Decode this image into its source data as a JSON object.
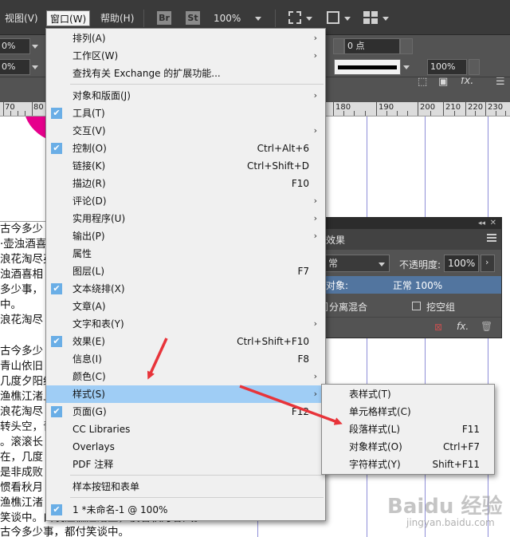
{
  "menubar": {
    "items": [
      {
        "label": "视图(V)"
      },
      {
        "label": "窗口(W)",
        "active": true
      },
      {
        "label": "帮助(H)"
      }
    ],
    "bridge_badge": "Br",
    "stock_badge": "St",
    "zoom": "100%"
  },
  "control": {
    "left_value_1": "0%",
    "left_value_2": "0%",
    "stroke_weight": "0 点",
    "opacity": "100%",
    "fx_label": "fx."
  },
  "ruler": {
    "ticks": [
      "70",
      "80",
      "180",
      "190",
      "200",
      "210",
      "220",
      "230"
    ]
  },
  "document": {
    "lines": [
      "古今多少",
      "·壶浊酒喜",
      "浪花淘尽英",
      "浊酒喜相",
      "多少事，",
      "中。",
      "浪花淘尽",
      "",
      "古今多少",
      "青山依旧",
      "几度夕阳红。",
      "渔樵江渚上，",
      "浪花淘尽",
      "转头空，青",
      "。滚滚长",
      "在，几度",
      "是非成败",
      "惯看秋月",
      "渔樵江渚",
      "笑谈中。白发渔樵江渚上，惯看秋月春风。",
      "古今多少事，都付笑谈中。"
    ]
  },
  "effects_panel": {
    "tab_title": "效果",
    "blend_mode": "常",
    "opacity_label": "不透明度:",
    "opacity_value": "100%",
    "object_label": "对象:",
    "object_value": "正常 100%",
    "isolate_label": "分离混合",
    "knockout_label": "挖空组",
    "fx_label": "fx."
  },
  "window_menu": {
    "items": [
      {
        "label": "排列(A)",
        "submenu": true
      },
      {
        "label": "工作区(W)",
        "submenu": true
      },
      {
        "label": "查找有关 Exchange 的扩展功能..."
      },
      {
        "label": "对象和版面(J)",
        "submenu": true
      },
      {
        "label": "工具(T)",
        "checked": true
      },
      {
        "label": "交互(V)",
        "submenu": true
      },
      {
        "label": "控制(O)",
        "shortcut": "Ctrl+Alt+6",
        "checked": true
      },
      {
        "label": "链接(K)",
        "shortcut": "Ctrl+Shift+D"
      },
      {
        "label": "描边(R)",
        "shortcut": "F10"
      },
      {
        "label": "评论(D)",
        "submenu": true
      },
      {
        "label": "实用程序(U)",
        "submenu": true
      },
      {
        "label": "输出(P)",
        "submenu": true
      },
      {
        "label": "属性"
      },
      {
        "label": "图层(L)",
        "shortcut": "F7"
      },
      {
        "label": "文本绕排(X)",
        "checked": true
      },
      {
        "label": "文章(A)"
      },
      {
        "label": "文字和表(Y)",
        "submenu": true
      },
      {
        "label": "效果(E)",
        "shortcut": "Ctrl+Shift+F10",
        "checked": true
      },
      {
        "label": "信息(I)",
        "shortcut": "F8"
      },
      {
        "label": "颜色(C)",
        "submenu": true
      },
      {
        "label": "样式(S)",
        "submenu": true,
        "highlighted": true
      },
      {
        "label": "页面(G)",
        "shortcut": "F12",
        "checked": true
      },
      {
        "label": "CC Libraries"
      },
      {
        "label": "Overlays"
      },
      {
        "label": "PDF 注释"
      },
      {
        "label": "样本按钮和表单"
      },
      {
        "label": "1 *未命名-1 @ 100%",
        "checked": true
      }
    ]
  },
  "styles_submenu": {
    "items": [
      {
        "label": "表样式(T)"
      },
      {
        "label": "单元格样式(C)"
      },
      {
        "label": "段落样式(L)",
        "shortcut": "F11"
      },
      {
        "label": "对象样式(O)",
        "shortcut": "Ctrl+F7"
      },
      {
        "label": "字符样式(Y)",
        "shortcut": "Shift+F11"
      }
    ]
  },
  "watermark": {
    "brand": "Baidu 经验",
    "url": "jingyan.baidu.com"
  },
  "colors": {
    "menu_highlight": "#9fcdf5",
    "check_blue": "#6aaee6",
    "annotation_red": "#e8343a",
    "magenta": "#e6008c"
  }
}
